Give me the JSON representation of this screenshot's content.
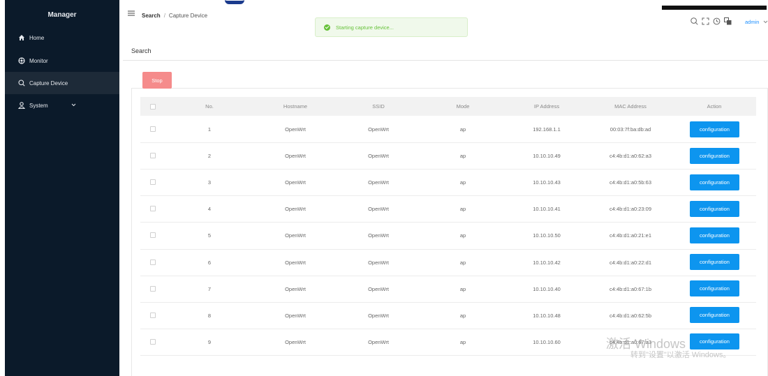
{
  "sidebar": {
    "brand": "Manager",
    "items": [
      {
        "label": "Home",
        "icon": "home-icon"
      },
      {
        "label": "Monitor",
        "icon": "monitor-icon"
      },
      {
        "label": "Capture Device",
        "icon": "search-icon"
      },
      {
        "label": "System",
        "icon": "user-icon"
      }
    ]
  },
  "breadcrumb": {
    "current": "Search",
    "separator": "/",
    "page": "Capture Device"
  },
  "toast": {
    "message": "Starting capture device..."
  },
  "header": {
    "user": "admin",
    "icons": [
      "search-icon",
      "fullscreen-icon",
      "history-icon",
      "translate-icon"
    ]
  },
  "page": {
    "title": "Search"
  },
  "toolbar": {
    "stop_label": "Stop"
  },
  "table": {
    "headers": [
      "No.",
      "Hostname",
      "SSID",
      "Mode",
      "IP Address",
      "MAC Address",
      "Action"
    ],
    "action_label": "configuration",
    "rows": [
      {
        "no": "1",
        "hostname": "OpenWrt",
        "ssid": "OpenWrt",
        "mode": "ap",
        "ip": "192.168.1.1",
        "mac": "00:03:7f:ba:db:ad"
      },
      {
        "no": "2",
        "hostname": "OpenWrt",
        "ssid": "OpenWrt",
        "mode": "ap",
        "ip": "10.10.10.49",
        "mac": "c4:4b:d1:a0:62:a3"
      },
      {
        "no": "3",
        "hostname": "OpenWrt",
        "ssid": "OpenWrt",
        "mode": "ap",
        "ip": "10.10.10.43",
        "mac": "c4:4b:d1:a0:5b:63"
      },
      {
        "no": "4",
        "hostname": "OpenWrt",
        "ssid": "OpenWrt",
        "mode": "ap",
        "ip": "10.10.10.41",
        "mac": "c4:4b:d1:a0:23:09"
      },
      {
        "no": "5",
        "hostname": "OpenWrt",
        "ssid": "OpenWrt",
        "mode": "ap",
        "ip": "10.10.10.50",
        "mac": "c4:4b:d1:a0:21:e1"
      },
      {
        "no": "6",
        "hostname": "OpenWrt",
        "ssid": "OpenWrt",
        "mode": "ap",
        "ip": "10.10.10.42",
        "mac": "c4:4b:d1:a0:22:d1"
      },
      {
        "no": "7",
        "hostname": "OpenWrt",
        "ssid": "OpenWrt",
        "mode": "ap",
        "ip": "10.10.10.40",
        "mac": "c4:4b:d1:a0:67:1b"
      },
      {
        "no": "8",
        "hostname": "OpenWrt",
        "ssid": "OpenWrt",
        "mode": "ap",
        "ip": "10.10.10.48",
        "mac": "c4:4b:d1:a0:62:5b"
      },
      {
        "no": "9",
        "hostname": "OpenWrt",
        "ssid": "OpenWrt",
        "mode": "ap",
        "ip": "10.10.10.60",
        "mac": "c4:4b:d1:a0:67:a3"
      }
    ]
  },
  "watermark": {
    "line1": "激活 Windows",
    "line2": "转到\"设置\"以激活 Windows。"
  },
  "colors": {
    "sidebar": "#0b1a2a",
    "primary": "#0d95ef",
    "danger": "#f58b8b",
    "success": "#67c23a"
  }
}
